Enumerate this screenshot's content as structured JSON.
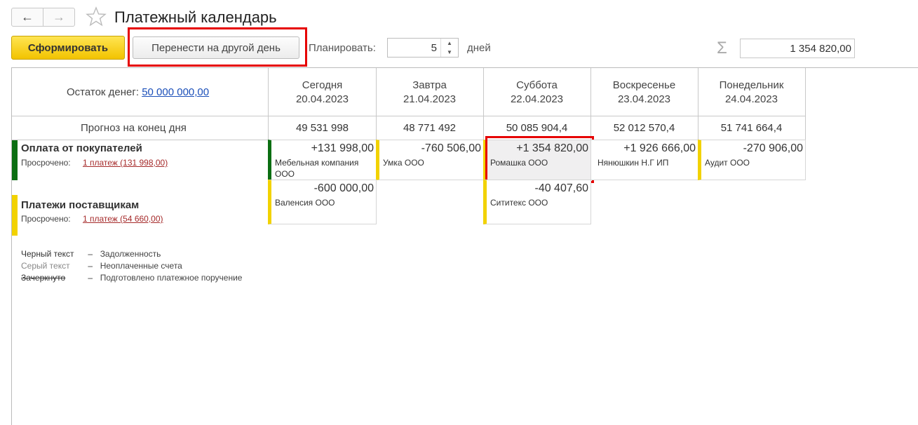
{
  "window": {
    "title": "Платежный календарь"
  },
  "nav": {
    "back_icon": "arrow-left-icon",
    "forward_icon": "arrow-right-icon",
    "favorite_icon": "star-icon"
  },
  "toolbar": {
    "generate_label": "Сформировать",
    "move_label": "Перенести на другой день",
    "plan_label": "Планировать:",
    "plan_days": "5",
    "days_label": "дней",
    "sum_value": "1 354 820,00"
  },
  "balance": {
    "label": "Остаток денег:",
    "value": "50 000 000,00"
  },
  "days": [
    {
      "name": "Сегодня",
      "date": "20.04.2023",
      "forecast": "49 531 998"
    },
    {
      "name": "Завтра",
      "date": "21.04.2023",
      "forecast": "48 771 492"
    },
    {
      "name": "Суббота",
      "date": "22.04.2023",
      "forecast": "50 085 904,4"
    },
    {
      "name": "Воскресенье",
      "date": "23.04.2023",
      "forecast": "52 012 570,4"
    },
    {
      "name": "Понедельник",
      "date": "24.04.2023",
      "forecast": "51 741 664,4"
    }
  ],
  "forecast_label": "Прогноз на конец дня",
  "sections": [
    {
      "title": "Оплата от покупателей",
      "overdue_label": "Просрочено:",
      "overdue_link": "1 платеж (131 998,00)",
      "cells": [
        {
          "amount": "+131 998,00",
          "counterparty": "Мебельная компания ООО"
        },
        {
          "amount": "-760 506,00",
          "counterparty": "Умка ООО"
        },
        {
          "amount": "+1 354 820,00",
          "counterparty": "Ромашка ООО"
        },
        {
          "amount": "+1 926 666,00",
          "counterparty": "Нянюшкин Н.Г ИП"
        },
        {
          "amount": "-270 906,00",
          "counterparty": "Аудит ООО"
        }
      ]
    },
    {
      "title": "Платежи поставщикам",
      "overdue_label": "Просрочено:",
      "overdue_link": "1 платеж (54 660,00)",
      "cells": [
        {
          "amount": "-600 000,00",
          "counterparty": "Валенсия ООО"
        },
        {
          "amount": "-40 407,60",
          "counterparty": "Сититекс ООО"
        }
      ]
    }
  ],
  "legend": [
    {
      "key": "Черный текст",
      "dash": "–",
      "value": "Задолженность"
    },
    {
      "key": "Серый текст",
      "dash": "–",
      "value": "Неоплаченные счета"
    },
    {
      "key": "Зачеркнуто",
      "dash": "–",
      "value": "Подготовлено платежное поручение"
    }
  ],
  "colors": {
    "accent_yellow": "#f2c300",
    "income_green": "#0b6e12",
    "payment_yellow": "#f2d200",
    "highlight_red": "#e60000",
    "link_blue": "#1b4fb9",
    "overdue_red": "#a52a2a"
  }
}
